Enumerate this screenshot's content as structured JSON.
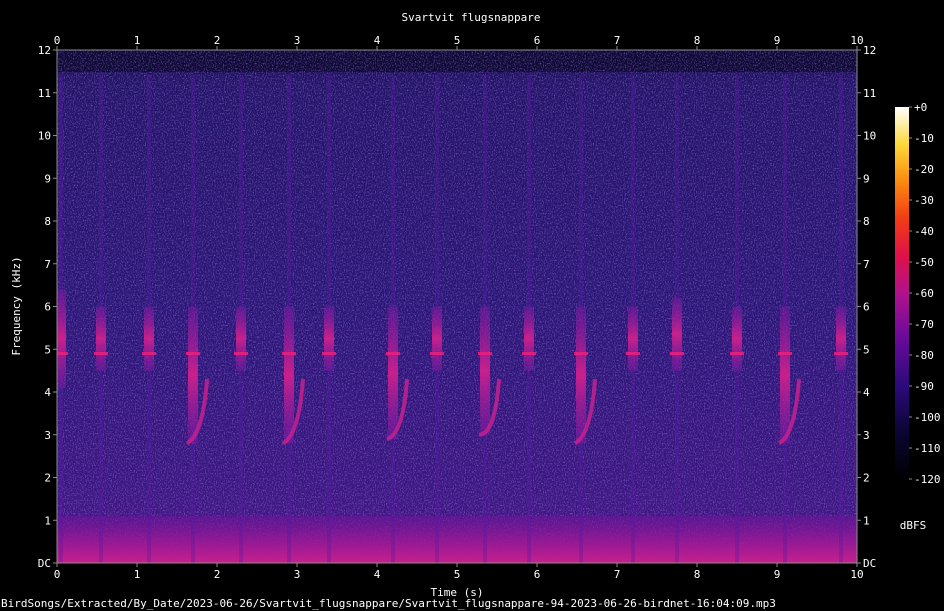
{
  "chart_data": {
    "type": "heatmap",
    "title": "Svartvit flugsnappare",
    "xlabel": "Time (s)",
    "ylabel": "Frequency (kHz)",
    "xlim": [
      0,
      10
    ],
    "ylim": [
      0,
      12
    ],
    "x_ticks": [
      "0",
      "1",
      "2",
      "3",
      "4",
      "5",
      "6",
      "7",
      "8",
      "9",
      "10"
    ],
    "y_ticks": [
      "DC",
      "1",
      "2",
      "3",
      "4",
      "5",
      "6",
      "7",
      "8",
      "9",
      "10",
      "11",
      "12"
    ],
    "colorbar": {
      "label": "dBFS",
      "range": [
        -120,
        0
      ],
      "ticks": [
        "+0",
        "-10",
        "-20",
        "-30",
        "-40",
        "-50",
        "-60",
        "-70",
        "-80",
        "-90",
        "-100",
        "-110",
        "-120"
      ]
    },
    "noise_floor_top_khz": 11.5,
    "low_freq_band_khz": 1.1,
    "syllables": [
      {
        "t": 0.05,
        "start_khz": 6.4,
        "end_khz": 4.1
      },
      {
        "t": 0.55,
        "start_khz": 6.0,
        "end_khz": 4.5
      },
      {
        "t": 1.15,
        "start_khz": 6.0,
        "end_khz": 4.5
      },
      {
        "t": 1.7,
        "start_khz": 6.0,
        "end_khz": 2.8
      },
      {
        "t": 2.3,
        "start_khz": 6.0,
        "end_khz": 4.5
      },
      {
        "t": 2.9,
        "start_khz": 6.0,
        "end_khz": 2.8
      },
      {
        "t": 3.4,
        "start_khz": 6.0,
        "end_khz": 4.5
      },
      {
        "t": 4.2,
        "start_khz": 6.0,
        "end_khz": 2.9
      },
      {
        "t": 4.75,
        "start_khz": 6.0,
        "end_khz": 4.5
      },
      {
        "t": 5.35,
        "start_khz": 6.0,
        "end_khz": 3.0
      },
      {
        "t": 5.9,
        "start_khz": 6.0,
        "end_khz": 4.5
      },
      {
        "t": 6.55,
        "start_khz": 6.0,
        "end_khz": 2.8
      },
      {
        "t": 7.2,
        "start_khz": 6.0,
        "end_khz": 4.5
      },
      {
        "t": 7.75,
        "start_khz": 6.2,
        "end_khz": 4.5
      },
      {
        "t": 8.5,
        "start_khz": 6.0,
        "end_khz": 4.5
      },
      {
        "t": 9.1,
        "start_khz": 6.0,
        "end_khz": 2.8
      },
      {
        "t": 9.8,
        "start_khz": 6.0,
        "end_khz": 4.5
      }
    ]
  },
  "footer": {
    "path": "BirdSongs/Extracted/By_Date/2023-06-26/Svartvit_flugsnappare/Svartvit_flugsnappare-94-2023-06-26-birdnet-16:04:09.mp3"
  }
}
